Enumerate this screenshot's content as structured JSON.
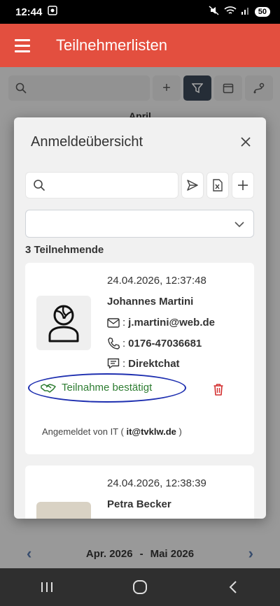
{
  "status_bar": {
    "time": "12:44",
    "battery": "50"
  },
  "app_bar": {
    "title": "Teilnehmerlisten"
  },
  "background": {
    "month": "April",
    "period_from": "Apr. 2026",
    "period_sep": "-",
    "period_to": "Mai 2026"
  },
  "modal": {
    "title": "Anmeldeübersicht",
    "search_placeholder": "",
    "filter_value": "",
    "participant_count": "3 Teilnehmende",
    "participants": [
      {
        "date": "24.04.2026, 12:37:48",
        "name": "Johannes Martini",
        "email": "j.martini@web.de",
        "phone": "0176-47036681",
        "chat": "Direktchat",
        "status": "Teilnahme bestätigt",
        "registered_prefix": "Angemeldet von IT (",
        "registered_email": "it@tvklw.de",
        "registered_suffix": ")"
      },
      {
        "date": "24.04.2026, 12:38:39",
        "name": "Petra Becker"
      }
    ]
  },
  "colors": {
    "brand": "#e34f3f",
    "confirm_green": "#2e7d32",
    "delete_red": "#d32f2f",
    "highlight_ellipse": "#1e2fb0"
  }
}
